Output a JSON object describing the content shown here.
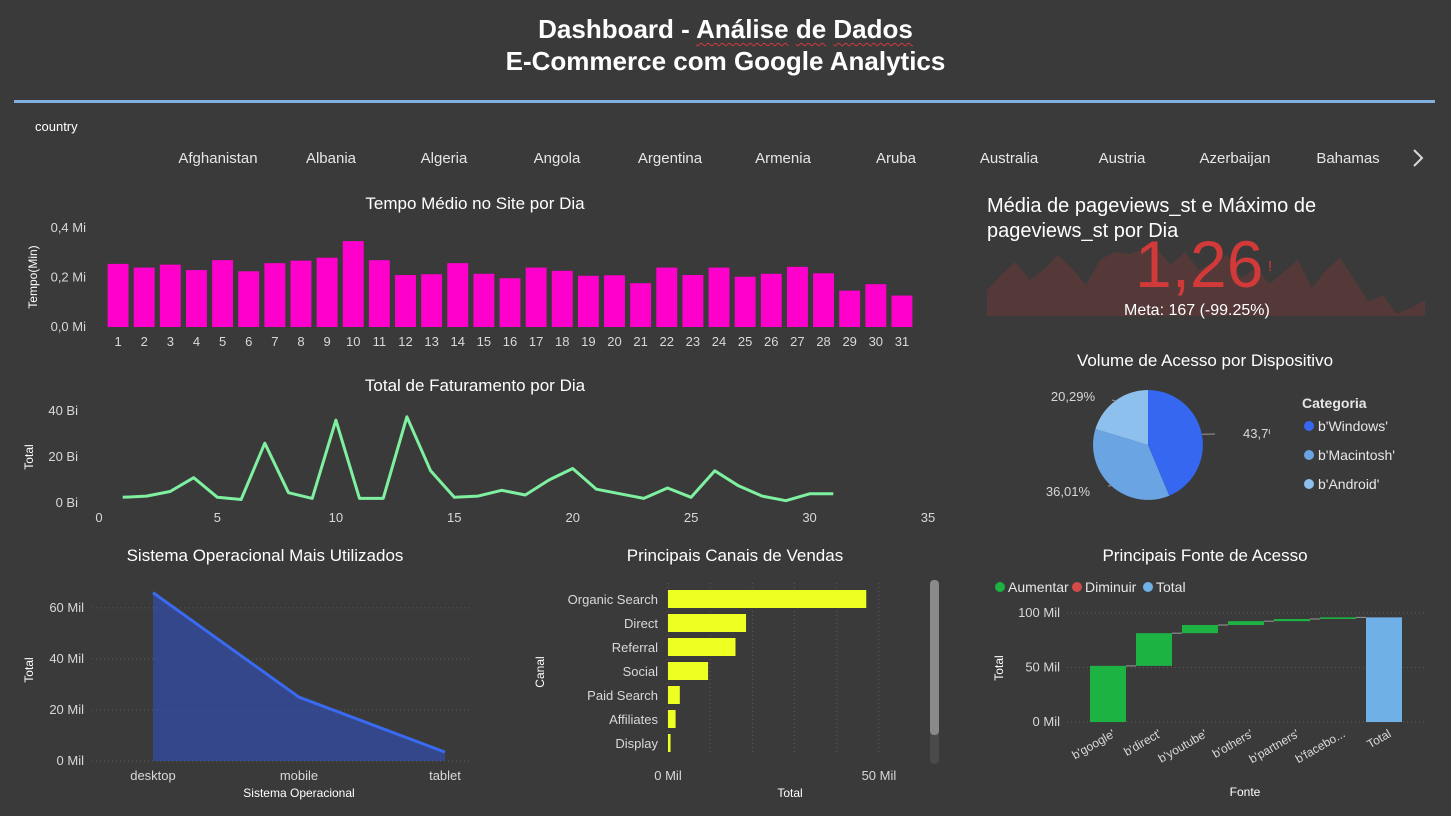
{
  "header": {
    "line1_prefix": "Dashboard - ",
    "line1_word1": "Análise",
    "line1_word2": "de",
    "line1_word3": "Dados",
    "line2": "E-Commerce com Google Analytics"
  },
  "slicer": {
    "label": "country",
    "items": [
      "Afghanistan",
      "Albania",
      "Algeria",
      "Angola",
      "Argentina",
      "Armenia",
      "Aruba",
      "Australia",
      "Austria",
      "Azerbaijan",
      "Bahamas"
    ]
  },
  "colors": {
    "background": "#3a3a3a",
    "magenta": "#ff00cc",
    "green_line": "#7ef0a0",
    "blue_area": "#3050c0",
    "yellow": "#eeff22",
    "increase": "#1db343",
    "decrease": "#d24a4a",
    "total": "#6fb0e6",
    "kpi_red": "#d23a3a"
  },
  "kpi": {
    "title": "Média de pageviews_st e Máximo de pageviews_st por Dia",
    "value": "1,26",
    "indicator": "!",
    "goal": "Meta: 167 (-99.25%)"
  },
  "chart_data": [
    {
      "type": "bar",
      "title": "Tempo Médio no Site por Dia",
      "ylabel": "Tempo(Min)",
      "y_ticks": [
        "0,0 Mi",
        "0,2 Mi",
        "0,4 Mi"
      ],
      "ylim": [
        0,
        0.4
      ],
      "categories": [
        "1",
        "2",
        "3",
        "4",
        "5",
        "6",
        "7",
        "8",
        "9",
        "10",
        "11",
        "12",
        "13",
        "14",
        "15",
        "16",
        "17",
        "18",
        "19",
        "20",
        "21",
        "22",
        "23",
        "24",
        "25",
        "26",
        "27",
        "28",
        "29",
        "30",
        "31"
      ],
      "values": [
        0.255,
        0.24,
        0.252,
        0.23,
        0.27,
        0.225,
        0.258,
        0.268,
        0.28,
        0.347,
        0.27,
        0.21,
        0.213,
        0.258,
        0.215,
        0.197,
        0.24,
        0.227,
        0.207,
        0.209,
        0.177,
        0.24,
        0.21,
        0.24,
        0.203,
        0.215,
        0.243,
        0.217,
        0.147,
        0.173,
        0.127
      ]
    },
    {
      "type": "line",
      "title": "Total de Faturamento por Dia",
      "ylabel": "Total",
      "y_ticks": [
        "0 Bi",
        "20 Bi",
        "40 Bi"
      ],
      "ylim": [
        0,
        40
      ],
      "x_ticks": [
        "0",
        "5",
        "10",
        "15",
        "20",
        "25",
        "30",
        "35"
      ],
      "xlim": [
        0,
        35
      ],
      "x": [
        1,
        2,
        3,
        4,
        5,
        6,
        7,
        8,
        9,
        10,
        11,
        12,
        13,
        14,
        15,
        16,
        17,
        18,
        19,
        20,
        21,
        22,
        23,
        24,
        25,
        26,
        27,
        28,
        29,
        30,
        31
      ],
      "values": [
        2.5,
        3,
        5,
        11,
        2.5,
        1.5,
        26,
        4.5,
        2,
        36,
        2,
        2,
        37.5,
        14,
        2.5,
        3,
        5.5,
        3.5,
        10,
        15,
        6,
        4,
        2,
        6.5,
        2.5,
        14,
        7.5,
        3,
        1,
        4,
        4
      ]
    },
    {
      "type": "area",
      "title": "Sistema Operacional Mais Utilizados",
      "xlabel": "Sistema Operacional",
      "ylabel": "Total",
      "y_ticks": [
        "0 Mil",
        "20 Mil",
        "40 Mil",
        "60 Mil"
      ],
      "ylim": [
        0,
        67
      ],
      "categories": [
        "desktop",
        "mobile",
        "tablet"
      ],
      "values": [
        66,
        25,
        3.5
      ]
    },
    {
      "type": "bar",
      "orientation": "horizontal",
      "title": "Principais Canais de Vendas",
      "xlabel": "Total",
      "ylabel": "Canal",
      "x_ticks": [
        "0 Mil",
        "50 Mil"
      ],
      "xlim": [
        0,
        55
      ],
      "categories": [
        "Organic Search",
        "Direct",
        "Referral",
        "Social",
        "Paid Search",
        "Affiliates",
        "Display"
      ],
      "values": [
        47,
        18.5,
        16,
        9.5,
        2.8,
        1.8,
        0.6
      ]
    },
    {
      "type": "pie",
      "title": "Volume de Acesso por Dispositivo",
      "legend_title": "Categoria",
      "labels": [
        "b'Windows'",
        "b'Macintosh'",
        "b'Android'"
      ],
      "values": [
        43.7,
        36.01,
        20.29
      ],
      "value_labels": [
        "43,7%",
        "36,01%",
        "20,29%"
      ],
      "colors": [
        "#3567f0",
        "#6aa4e2",
        "#8ec0ee"
      ]
    },
    {
      "type": "bar",
      "subtype": "waterfall",
      "title": "Principais Fonte de Acesso",
      "xlabel": "Fonte",
      "ylabel": "Total",
      "legend": [
        "Aumentar",
        "Diminuir",
        "Total"
      ],
      "y_ticks": [
        "0 Mil",
        "50 Mil",
        "100 Mil"
      ],
      "ylim": [
        0,
        100
      ],
      "categories": [
        "b'google'",
        "b'direct'",
        "b'youtube'",
        "b'others'",
        "b'partners'",
        "b'facebo...",
        "Total"
      ],
      "values": [
        51.5,
        30,
        7.5,
        3.5,
        2,
        1.5,
        96
      ]
    }
  ]
}
